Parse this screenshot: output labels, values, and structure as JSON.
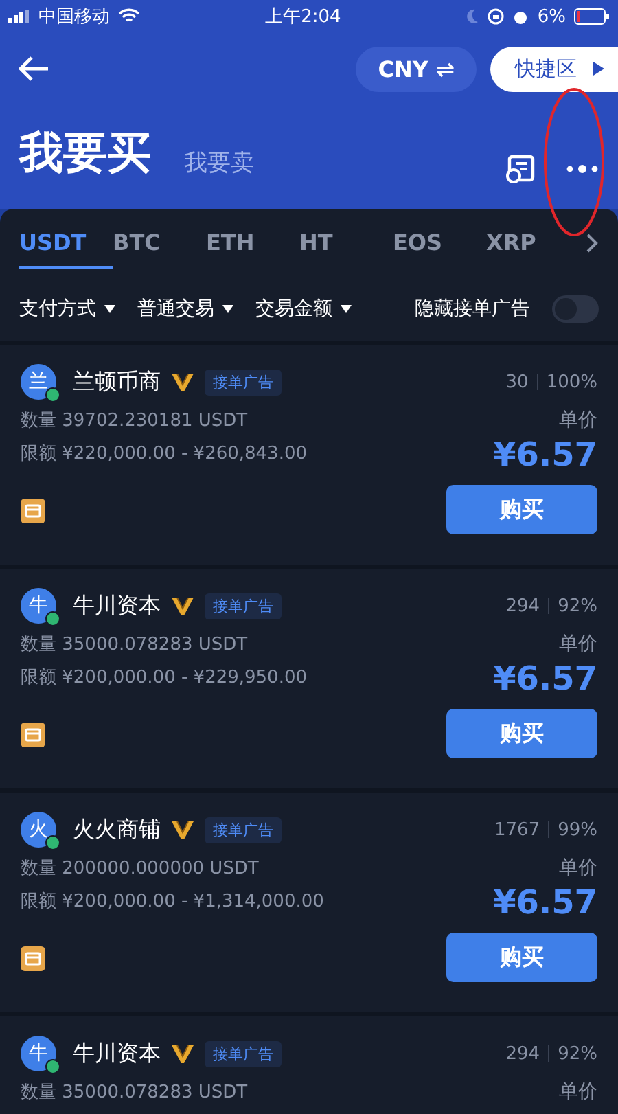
{
  "status_bar": {
    "carrier": "中国移动",
    "time": "上午2:04",
    "battery": "6%"
  },
  "header": {
    "currency": "CNY ⇌",
    "shortcut": "快捷区",
    "title": "我要买",
    "alt_title": "我要卖"
  },
  "tabs": [
    {
      "label": "USDT",
      "selected": true
    },
    {
      "label": "BTC",
      "selected": false
    },
    {
      "label": "ETH",
      "selected": false
    },
    {
      "label": "HT",
      "selected": false
    },
    {
      "label": "EOS",
      "selected": false
    },
    {
      "label": "XRP",
      "selected": false
    }
  ],
  "filters": [
    "支付方式",
    "普通交易",
    "交易金额"
  ],
  "hide_toggle": {
    "label": "隐藏接单广告",
    "on": false
  },
  "listings": [
    {
      "avatar": "兰",
      "name": "兰顿币商",
      "online": true,
      "tag": "接单广告",
      "orders": "30",
      "rate": "100%",
      "quantity": "数量 39702.230181 USDT",
      "limit": "限额 ¥220,000.00 - ¥260,843.00",
      "price_label": "单价",
      "price": "¥6.57",
      "button": "购买"
    },
    {
      "avatar": "牛",
      "name": "牛川资本",
      "online": true,
      "tag": "接单广告",
      "orders": "294",
      "rate": "92%",
      "quantity": "数量 35000.078283 USDT",
      "limit": "限额 ¥200,000.00 - ¥229,950.00",
      "price_label": "单价",
      "price": "¥6.57",
      "button": "购买"
    },
    {
      "avatar": "火",
      "name": "火火商铺",
      "online": true,
      "tag": "接单广告",
      "orders": "1767",
      "rate": "99%",
      "quantity": "数量 200000.000000 USDT",
      "limit": "限额 ¥200,000.00 - ¥1,314,000.00",
      "price_label": "单价",
      "price": "¥6.57",
      "button": "购买"
    },
    {
      "avatar": "牛",
      "name": "牛川资本",
      "online": true,
      "tag": "接单广告",
      "orders": "294",
      "rate": "92%",
      "quantity": "数量 35000.078283 USDT",
      "price_label": "单价"
    }
  ]
}
